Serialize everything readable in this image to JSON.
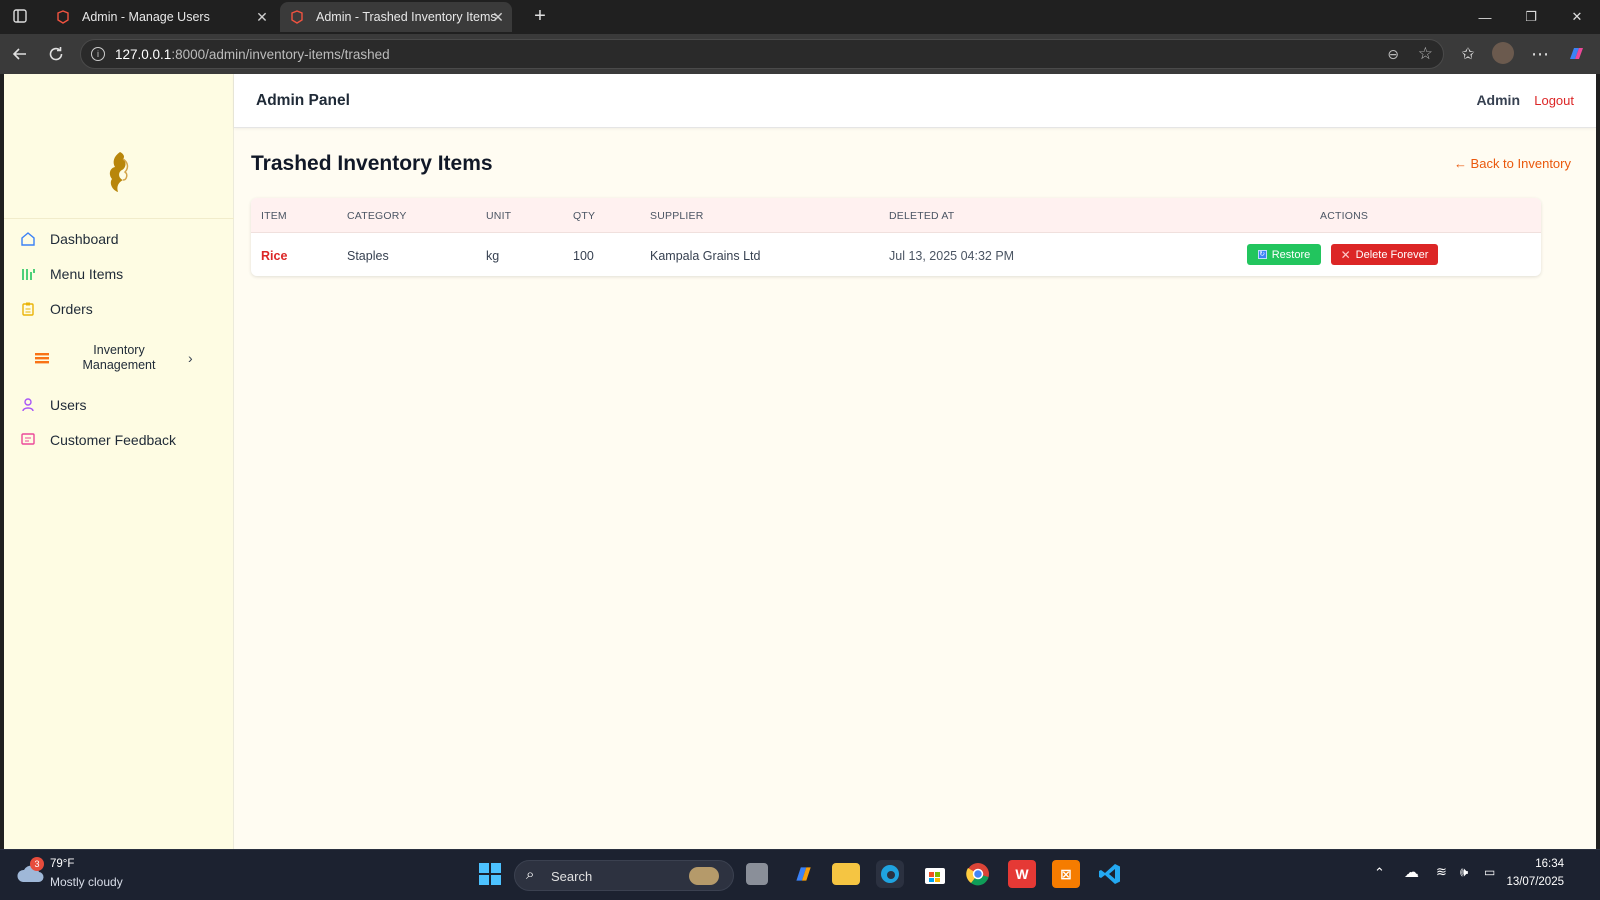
{
  "browser": {
    "tabs": [
      {
        "title": "Admin - Manage Users",
        "active": false
      },
      {
        "title": "Admin - Trashed Inventory Items",
        "active": true
      }
    ],
    "url_host": "127.0.0.1",
    "url_rest": ":8000/admin/inventory-items/trashed"
  },
  "sidebar": {
    "items": [
      {
        "label": "Dashboard",
        "icon": "home-icon",
        "color": "#3b82f6"
      },
      {
        "label": "Menu Items",
        "icon": "menu-bars-icon",
        "color": "#22c55e"
      },
      {
        "label": "Orders",
        "icon": "clipboard-icon",
        "color": "#eab308"
      },
      {
        "label": "Inventory Management",
        "icon": "stack-icon",
        "color": "#f97316"
      },
      {
        "label": "Users",
        "icon": "user-icon",
        "color": "#a855f7"
      },
      {
        "label": "Customer Feedback",
        "icon": "chat-icon",
        "color": "#ec4899"
      }
    ]
  },
  "header": {
    "panel_title": "Admin Panel",
    "user": "Admin",
    "logout": "Logout"
  },
  "main": {
    "title": "Trashed Inventory Items",
    "back_link": "← Back to Inventory",
    "columns": [
      "ITEM",
      "CATEGORY",
      "UNIT",
      "QTY",
      "SUPPLIER",
      "DELETED AT",
      "ACTIONS"
    ],
    "rows": [
      {
        "item": "Rice",
        "category": "Staples",
        "unit": "kg",
        "qty": "100",
        "supplier": "Kampala Grains Ltd",
        "deleted_at": "Jul 13, 2025 04:32 PM",
        "restore": "Restore",
        "delete": "Delete Forever"
      }
    ]
  },
  "taskbar": {
    "weather_badge": "3",
    "temperature": "79°F",
    "weather": "Mostly cloudy",
    "search": "Search",
    "time": "16:34",
    "date": "13/07/2025"
  },
  "colors": {
    "accent_red": "#dc2626",
    "restore_green": "#22c55e",
    "link_orange": "#ea580c",
    "page_bg": "#fffcf2",
    "sidebar_bg": "#fefce3"
  }
}
